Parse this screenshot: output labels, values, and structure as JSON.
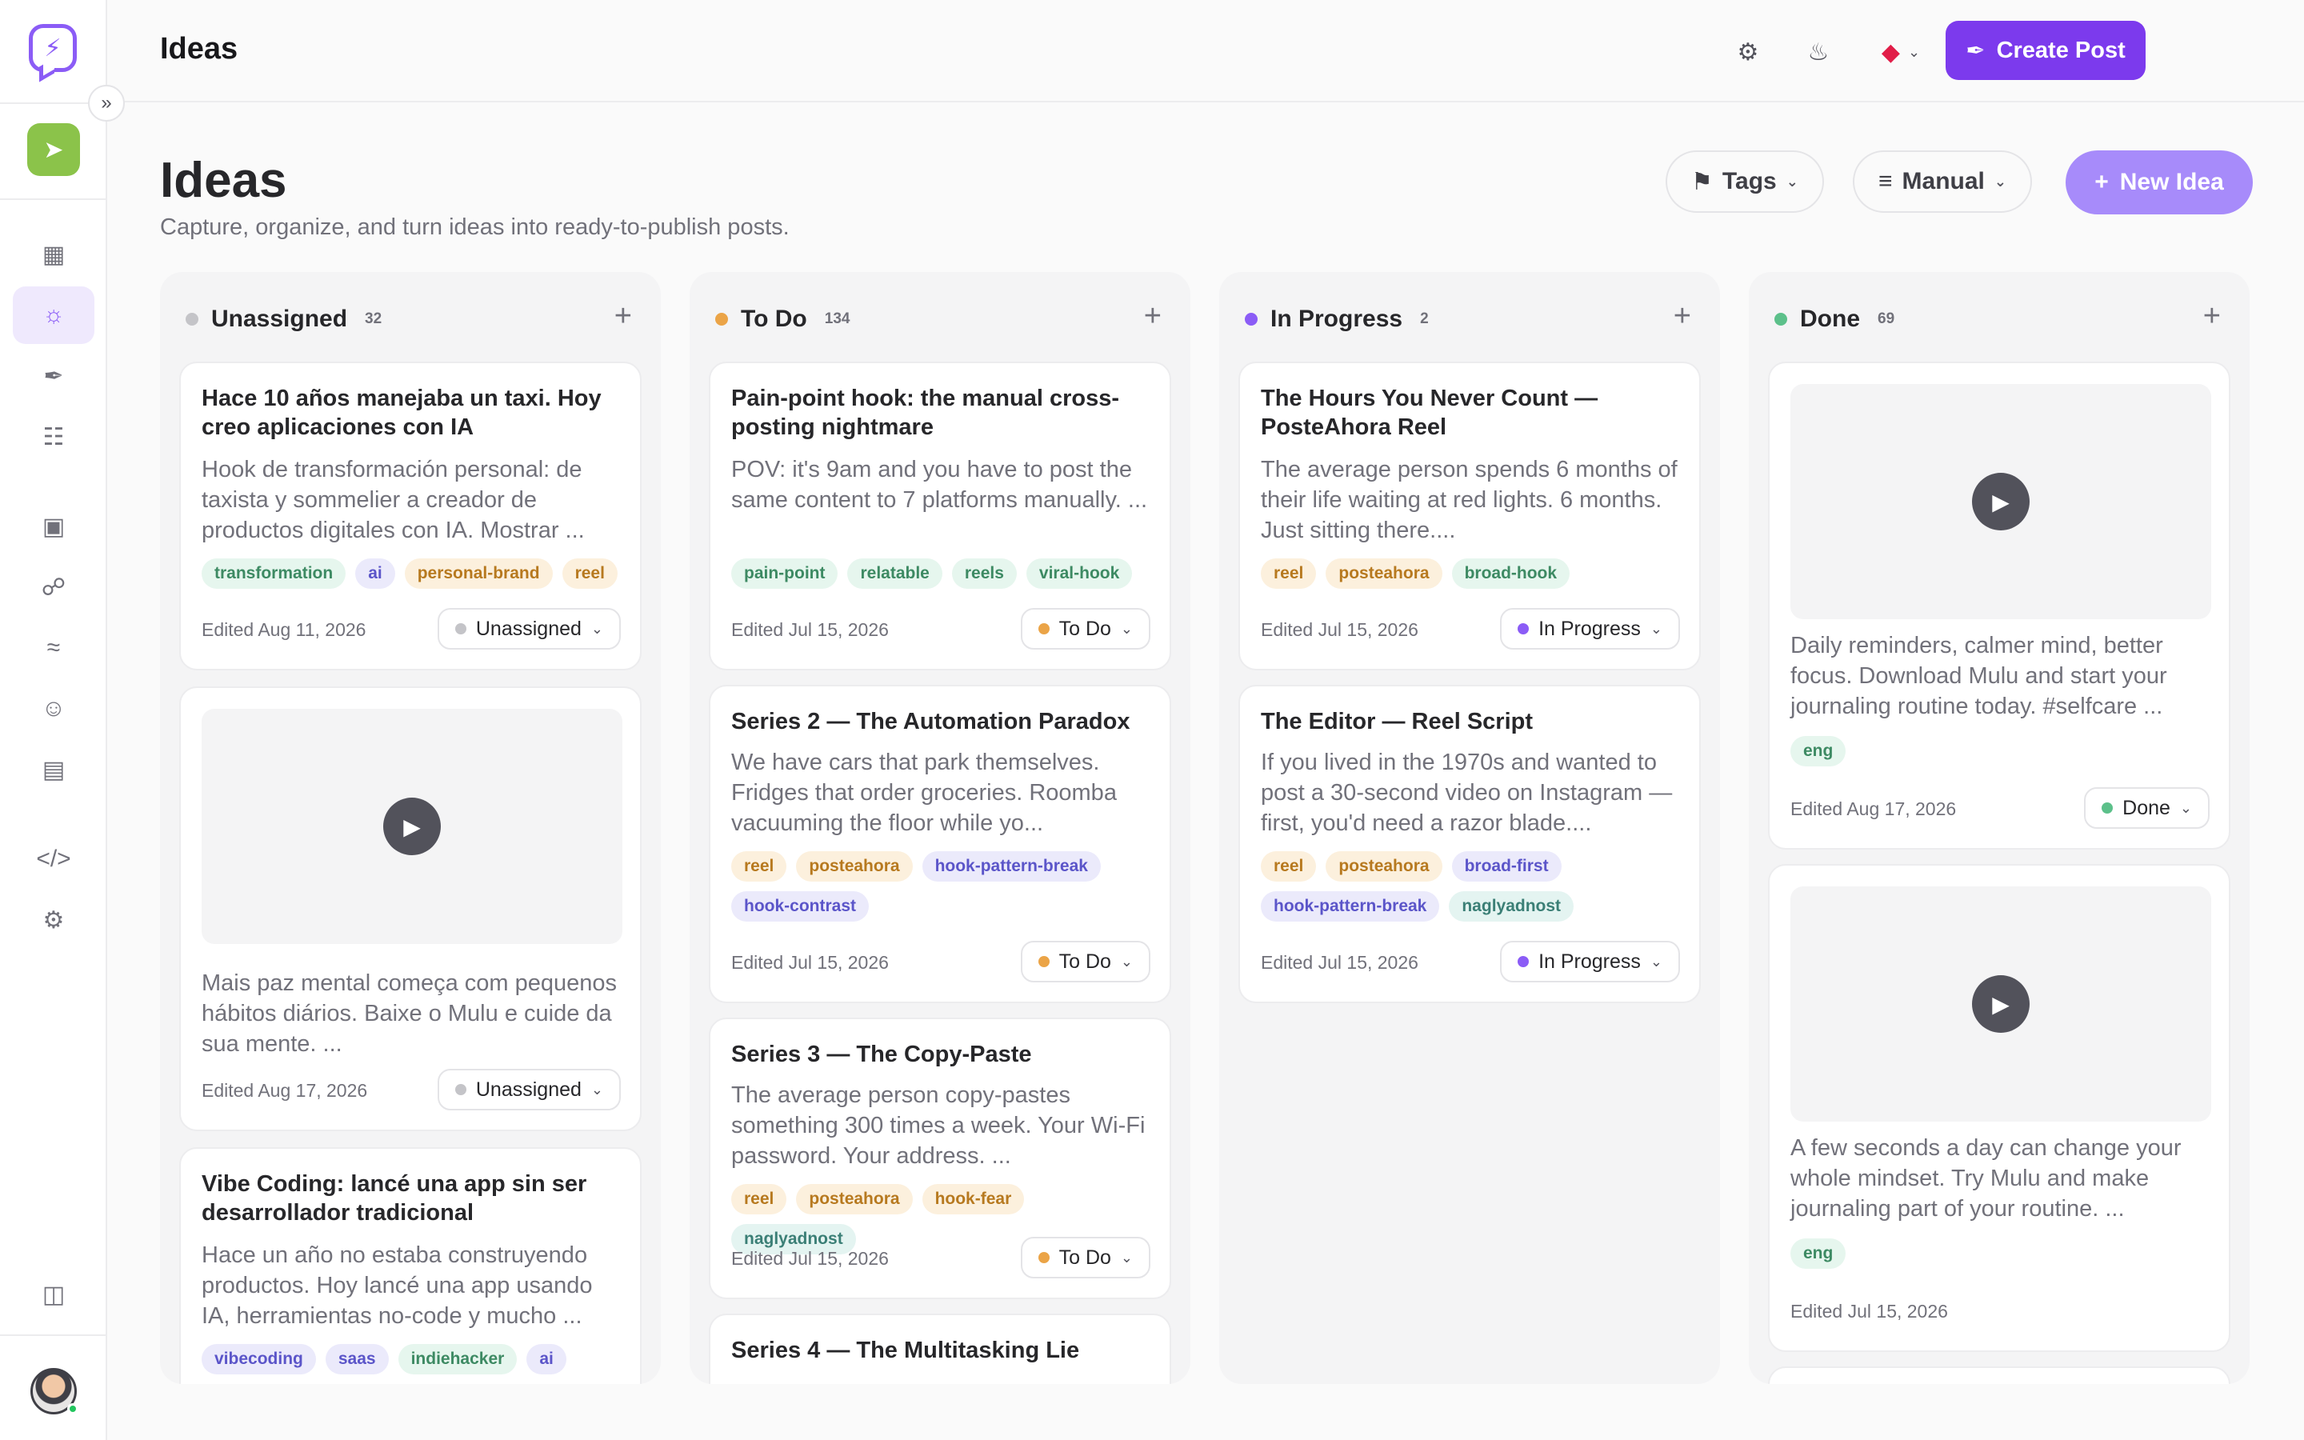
{
  "topbar": {
    "title": "Ideas",
    "create_post_label": "Create Post"
  },
  "page": {
    "title": "Ideas",
    "subtitle": "Capture, organize, and turn ideas into ready-to-publish posts.",
    "tags_filter_label": "Tags",
    "sort_label": "Manual",
    "new_idea_label": "New Idea"
  },
  "colors": {
    "accent": "#7c3aed",
    "unassigned": "#c4c4c8",
    "todo": "#eba447",
    "in_progress": "#8b5cf6",
    "done": "#5cc08a"
  },
  "columns": [
    {
      "title": "Unassigned",
      "count": "32",
      "cards": [
        {
          "title": "Hace 10 años manejaba un taxi. Hoy creo aplicaciones con IA",
          "desc": "Hook de transformación personal: de taxista y sommelier a creador de productos digitales con IA. Mostrar ...",
          "tags": [
            "transformation",
            "ai",
            "personal-brand",
            "reel"
          ],
          "date": "Edited Aug 11, 2026",
          "status": "Unassigned"
        },
        {
          "desc": "Mais paz mental começa com pequenos hábitos diários. Baixe o Mulu e cuide da sua mente. ...",
          "date": "Edited Aug 17, 2026",
          "status": "Unassigned"
        },
        {
          "title": "Vibe Coding: lancé una app sin ser desarrollador tradicional",
          "desc": "Hace un año no estaba construyendo productos. Hoy lancé una app usando IA, herramientas no-code y mucho ...",
          "tags": [
            "vibecoding",
            "saas",
            "indiehacker",
            "ai"
          ]
        }
      ]
    },
    {
      "title": "To Do",
      "count": "134",
      "cards": [
        {
          "title": "Pain-point hook: the manual cross-posting nightmare",
          "desc": "POV: it's 9am and you have to post the same content to 7 platforms manually. ...",
          "tags": [
            "pain-point",
            "relatable",
            "reels",
            "viral-hook"
          ],
          "date": "Edited Jul 15, 2026",
          "status": "To Do"
        },
        {
          "title": "Series 2 — The Automation Paradox",
          "desc": "We have cars that park themselves. Fridges that order groceries. Roomba vacuuming the floor while yo...",
          "tags": [
            "reel",
            "posteahora",
            "hook-pattern-break",
            "hook-contrast"
          ],
          "date": "Edited Jul 15, 2026",
          "status": "To Do"
        },
        {
          "title": "Series 3 — The Copy-Paste",
          "desc": "The average person copy-pastes something 300 times a week. Your Wi-Fi password. Your address. ...",
          "tags": [
            "reel",
            "posteahora",
            "hook-fear",
            "naglyadnost"
          ],
          "date": "Edited Jul 15, 2026",
          "status": "To Do"
        },
        {
          "title": "Series 4 — The Multitasking Lie"
        }
      ]
    },
    {
      "title": "In Progress",
      "count": "2",
      "cards": [
        {
          "title": "The Hours You Never Count — PosteAhora Reel",
          "desc": "The average person spends 6 months of their life waiting at red lights. 6 months. Just sitting there....",
          "tags": [
            "reel",
            "posteahora",
            "broad-hook"
          ],
          "date": "Edited Jul 15, 2026",
          "status": "In Progress"
        },
        {
          "title": "The Editor — Reel Script",
          "desc": "If you lived in the 1970s and wanted to post a 30-second video on Instagram — first, you'd need a razor blade....",
          "tags": [
            "reel",
            "posteahora",
            "broad-first",
            "hook-pattern-break",
            "naglyadnost"
          ],
          "date": "Edited Jul 15, 2026",
          "status": "In Progress"
        }
      ]
    },
    {
      "title": "Done",
      "count": "69",
      "cards": [
        {
          "desc": "Daily reminders, calmer mind, better focus. Download Mulu and start your journaling routine today. #selfcare ...",
          "tags": [
            "eng"
          ],
          "date": "Edited Aug 17, 2026",
          "status": "Done"
        },
        {
          "desc": "A few seconds a day can change your whole mindset. Try Mulu and make journaling part of your routine. ...",
          "tags": [
            "eng"
          ],
          "date": "Edited Jul 15, 2026"
        }
      ]
    }
  ]
}
